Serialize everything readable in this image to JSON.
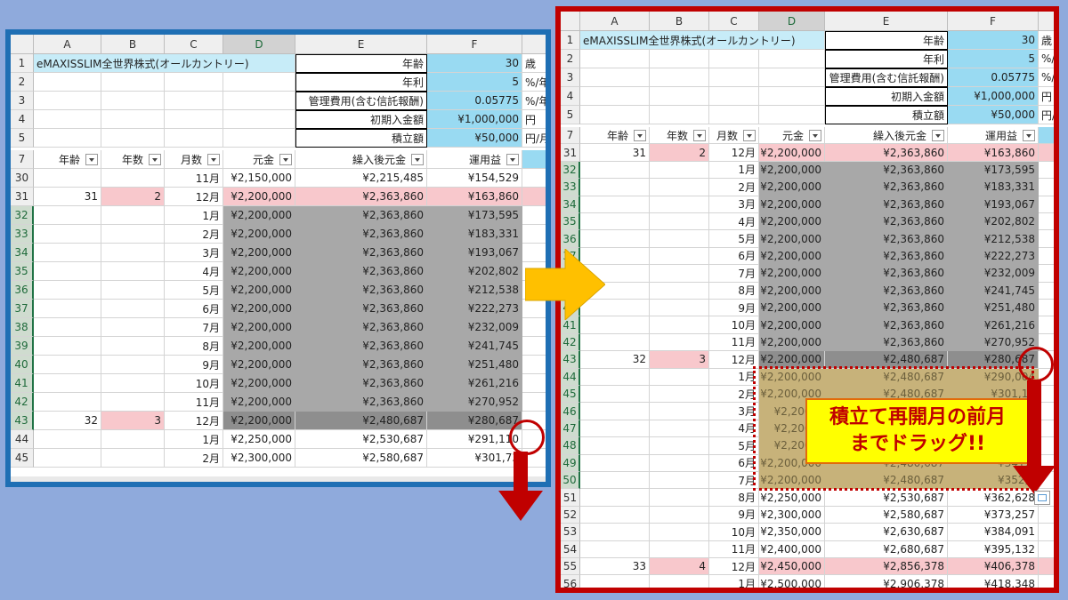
{
  "columns": [
    "A",
    "B",
    "C",
    "D",
    "E",
    "F"
  ],
  "header_rows": [
    {
      "num": "1",
      "a": "eMAXISSLIM全世界株式(オールカントリー)",
      "e": "年齢",
      "f": "30",
      "g": "歳"
    },
    {
      "num": "2",
      "a": "",
      "e": "年利",
      "f": "5",
      "g": "%/年"
    },
    {
      "num": "3",
      "a": "",
      "e": "管理費用(含む信託報酬)",
      "f": "0.05775",
      "g": "%/年"
    },
    {
      "num": "4",
      "a": "",
      "e": "初期入金額",
      "f": "¥1,000,000",
      "g": "円"
    },
    {
      "num": "5",
      "a": "",
      "e": "積立額",
      "f": "¥50,000",
      "g": "円/月"
    }
  ],
  "header_rows_right": [
    {
      "num": "1",
      "a": "eMAXISSLIM全世界株式(オールカントリー)",
      "e": "年齢",
      "f": "30",
      "g": "歳"
    },
    {
      "num": "2",
      "a": "",
      "e": "年利",
      "f": "5",
      "g": "%/"
    },
    {
      "num": "3",
      "a": "",
      "e": "管理費用(含む信託報酬)",
      "f": "0.05775",
      "g": "%/"
    },
    {
      "num": "4",
      "a": "",
      "e": "初期入金額",
      "f": "¥1,000,000",
      "g": "円"
    },
    {
      "num": "5",
      "a": "",
      "e": "積立額",
      "f": "¥50,000",
      "g": "円/"
    }
  ],
  "table_headers": {
    "num": "7",
    "age": "年齢",
    "years": "年数",
    "month": "月数",
    "principal": "元金",
    "carried": "繰入後元金",
    "profit": "運用益"
  },
  "left_rows": [
    {
      "num": "30",
      "age": "",
      "years": "",
      "month": "11月",
      "principal": "¥2,150,000",
      "carried": "¥2,215,485",
      "profit": "¥154,529",
      "style": "normal"
    },
    {
      "num": "31",
      "age": "31",
      "years": "2",
      "month": "12月",
      "principal": "¥2,200,000",
      "carried": "¥2,363,860",
      "profit": "¥163,860",
      "style": "pink"
    },
    {
      "num": "32",
      "age": "",
      "years": "",
      "month": "1月",
      "principal": "¥2,200,000",
      "carried": "¥2,363,860",
      "profit": "¥173,595",
      "style": "gray"
    },
    {
      "num": "33",
      "age": "",
      "years": "",
      "month": "2月",
      "principal": "¥2,200,000",
      "carried": "¥2,363,860",
      "profit": "¥183,331",
      "style": "gray"
    },
    {
      "num": "34",
      "age": "",
      "years": "",
      "month": "3月",
      "principal": "¥2,200,000",
      "carried": "¥2,363,860",
      "profit": "¥193,067",
      "style": "gray"
    },
    {
      "num": "35",
      "age": "",
      "years": "",
      "month": "4月",
      "principal": "¥2,200,000",
      "carried": "¥2,363,860",
      "profit": "¥202,802",
      "style": "gray"
    },
    {
      "num": "36",
      "age": "",
      "years": "",
      "month": "5月",
      "principal": "¥2,200,000",
      "carried": "¥2,363,860",
      "profit": "¥212,538",
      "style": "gray"
    },
    {
      "num": "37",
      "age": "",
      "years": "",
      "month": "6月",
      "principal": "¥2,200,000",
      "carried": "¥2,363,860",
      "profit": "¥222,273",
      "style": "gray"
    },
    {
      "num": "38",
      "age": "",
      "years": "",
      "month": "7月",
      "principal": "¥2,200,000",
      "carried": "¥2,363,860",
      "profit": "¥232,009",
      "style": "gray"
    },
    {
      "num": "39",
      "age": "",
      "years": "",
      "month": "8月",
      "principal": "¥2,200,000",
      "carried": "¥2,363,860",
      "profit": "¥241,745",
      "style": "gray"
    },
    {
      "num": "40",
      "age": "",
      "years": "",
      "month": "9月",
      "principal": "¥2,200,000",
      "carried": "¥2,363,860",
      "profit": "¥251,480",
      "style": "gray"
    },
    {
      "num": "41",
      "age": "",
      "years": "",
      "month": "10月",
      "principal": "¥2,200,000",
      "carried": "¥2,363,860",
      "profit": "¥261,216",
      "style": "gray"
    },
    {
      "num": "42",
      "age": "",
      "years": "",
      "month": "11月",
      "principal": "¥2,200,000",
      "carried": "¥2,363,860",
      "profit": "¥270,952",
      "style": "gray"
    },
    {
      "num": "43",
      "age": "32",
      "years": "3",
      "month": "12月",
      "principal": "¥2,200,000",
      "carried": "¥2,480,687",
      "profit": "¥280,687",
      "style": "pinkgray"
    },
    {
      "num": "44",
      "age": "",
      "years": "",
      "month": "1月",
      "principal": "¥2,250,000",
      "carried": "¥2,530,687",
      "profit": "¥291,110",
      "style": "normal"
    },
    {
      "num": "45",
      "age": "",
      "years": "",
      "month": "2月",
      "principal": "¥2,300,000",
      "carried": "¥2,580,687",
      "profit": "¥301,73",
      "style": "normal"
    }
  ],
  "right_rows": [
    {
      "num": "31",
      "age": "31",
      "years": "2",
      "month": "12月",
      "principal": "¥2,200,000",
      "carried": "¥2,363,860",
      "profit": "¥163,860",
      "style": "pink"
    },
    {
      "num": "32",
      "age": "",
      "years": "",
      "month": "1月",
      "principal": "¥2,200,000",
      "carried": "¥2,363,860",
      "profit": "¥173,595",
      "style": "gray"
    },
    {
      "num": "33",
      "age": "",
      "years": "",
      "month": "2月",
      "principal": "¥2,200,000",
      "carried": "¥2,363,860",
      "profit": "¥183,331",
      "style": "gray"
    },
    {
      "num": "34",
      "age": "",
      "years": "",
      "month": "3月",
      "principal": "¥2,200,000",
      "carried": "¥2,363,860",
      "profit": "¥193,067",
      "style": "gray"
    },
    {
      "num": "35",
      "age": "",
      "years": "",
      "month": "4月",
      "principal": "¥2,200,000",
      "carried": "¥2,363,860",
      "profit": "¥202,802",
      "style": "gray"
    },
    {
      "num": "36",
      "age": "",
      "years": "",
      "month": "5月",
      "principal": "¥2,200,000",
      "carried": "¥2,363,860",
      "profit": "¥212,538",
      "style": "gray"
    },
    {
      "num": "37",
      "age": "",
      "years": "",
      "month": "6月",
      "principal": "¥2,200,000",
      "carried": "¥2,363,860",
      "profit": "¥222,273",
      "style": "gray"
    },
    {
      "num": "38",
      "age": "",
      "years": "",
      "month": "7月",
      "principal": "¥2,200,000",
      "carried": "¥2,363,860",
      "profit": "¥232,009",
      "style": "gray"
    },
    {
      "num": "39",
      "age": "",
      "years": "",
      "month": "8月",
      "principal": "¥2,200,000",
      "carried": "¥2,363,860",
      "profit": "¥241,745",
      "style": "gray"
    },
    {
      "num": "40",
      "age": "",
      "years": "",
      "month": "9月",
      "principal": "¥2,200,000",
      "carried": "¥2,363,860",
      "profit": "¥251,480",
      "style": "gray"
    },
    {
      "num": "41",
      "age": "",
      "years": "",
      "month": "10月",
      "principal": "¥2,200,000",
      "carried": "¥2,363,860",
      "profit": "¥261,216",
      "style": "gray"
    },
    {
      "num": "42",
      "age": "",
      "years": "",
      "month": "11月",
      "principal": "¥2,200,000",
      "carried": "¥2,363,860",
      "profit": "¥270,952",
      "style": "gray"
    },
    {
      "num": "43",
      "age": "32",
      "years": "3",
      "month": "12月",
      "principal": "¥2,200,000",
      "carried": "¥2,480,687",
      "profit": "¥280,687",
      "style": "pinkgray"
    },
    {
      "num": "44",
      "age": "",
      "years": "",
      "month": "1月",
      "principal": "¥2,200,000",
      "carried": "¥2,480,687",
      "profit": "¥290,004",
      "style": "tan"
    },
    {
      "num": "45",
      "age": "",
      "years": "",
      "month": "2月",
      "principal": "¥2,200,000",
      "carried": "¥2,480,687",
      "profit": "¥301,11",
      "style": "tan"
    },
    {
      "num": "46",
      "age": "",
      "years": "",
      "month": "3月",
      "principal": "¥2,200,0",
      "carried": "",
      "profit": "",
      "style": "tan"
    },
    {
      "num": "47",
      "age": "",
      "years": "",
      "month": "4月",
      "principal": "¥2,200,0",
      "carried": "",
      "profit": "",
      "style": "tan"
    },
    {
      "num": "48",
      "age": "",
      "years": "",
      "month": "5月",
      "principal": "¥2,200,0",
      "carried": "",
      "profit": "",
      "style": "tan"
    },
    {
      "num": "49",
      "age": "",
      "years": "",
      "month": "6月",
      "principal": "¥2,200,000",
      "carried": "¥2,480,687",
      "profit": "¥341,9",
      "style": "tan"
    },
    {
      "num": "50",
      "age": "",
      "years": "",
      "month": "7月",
      "principal": "¥2,200,000",
      "carried": "¥2,480,687",
      "profit": "¥352,3",
      "style": "tan"
    },
    {
      "num": "51",
      "age": "",
      "years": "",
      "month": "8月",
      "principal": "¥2,250,000",
      "carried": "¥2,530,687",
      "profit": "¥362,628",
      "style": "normal"
    },
    {
      "num": "52",
      "age": "",
      "years": "",
      "month": "9月",
      "principal": "¥2,300,000",
      "carried": "¥2,580,687",
      "profit": "¥373,257",
      "style": "normal"
    },
    {
      "num": "53",
      "age": "",
      "years": "",
      "month": "10月",
      "principal": "¥2,350,000",
      "carried": "¥2,630,687",
      "profit": "¥384,091",
      "style": "normal"
    },
    {
      "num": "54",
      "age": "",
      "years": "",
      "month": "11月",
      "principal": "¥2,400,000",
      "carried": "¥2,680,687",
      "profit": "¥395,132",
      "style": "normal"
    },
    {
      "num": "55",
      "age": "33",
      "years": "4",
      "month": "12月",
      "principal": "¥2,450,000",
      "carried": "¥2,856,378",
      "profit": "¥406,378",
      "style": "pink"
    },
    {
      "num": "56",
      "age": "",
      "years": "",
      "month": "1月",
      "principal": "¥2,500,000",
      "carried": "¥2,906,378",
      "profit": "¥418,348",
      "style": "normal"
    }
  ],
  "callout": {
    "line1": "積立て再開月の前月",
    "line2": "までドラッグ!!"
  },
  "colors": {
    "left_frame": "#1f6fb4",
    "right_frame": "#c00000",
    "arrow": "#ffc000",
    "callout_bg": "#ffff00",
    "callout_text": "#c00000"
  }
}
